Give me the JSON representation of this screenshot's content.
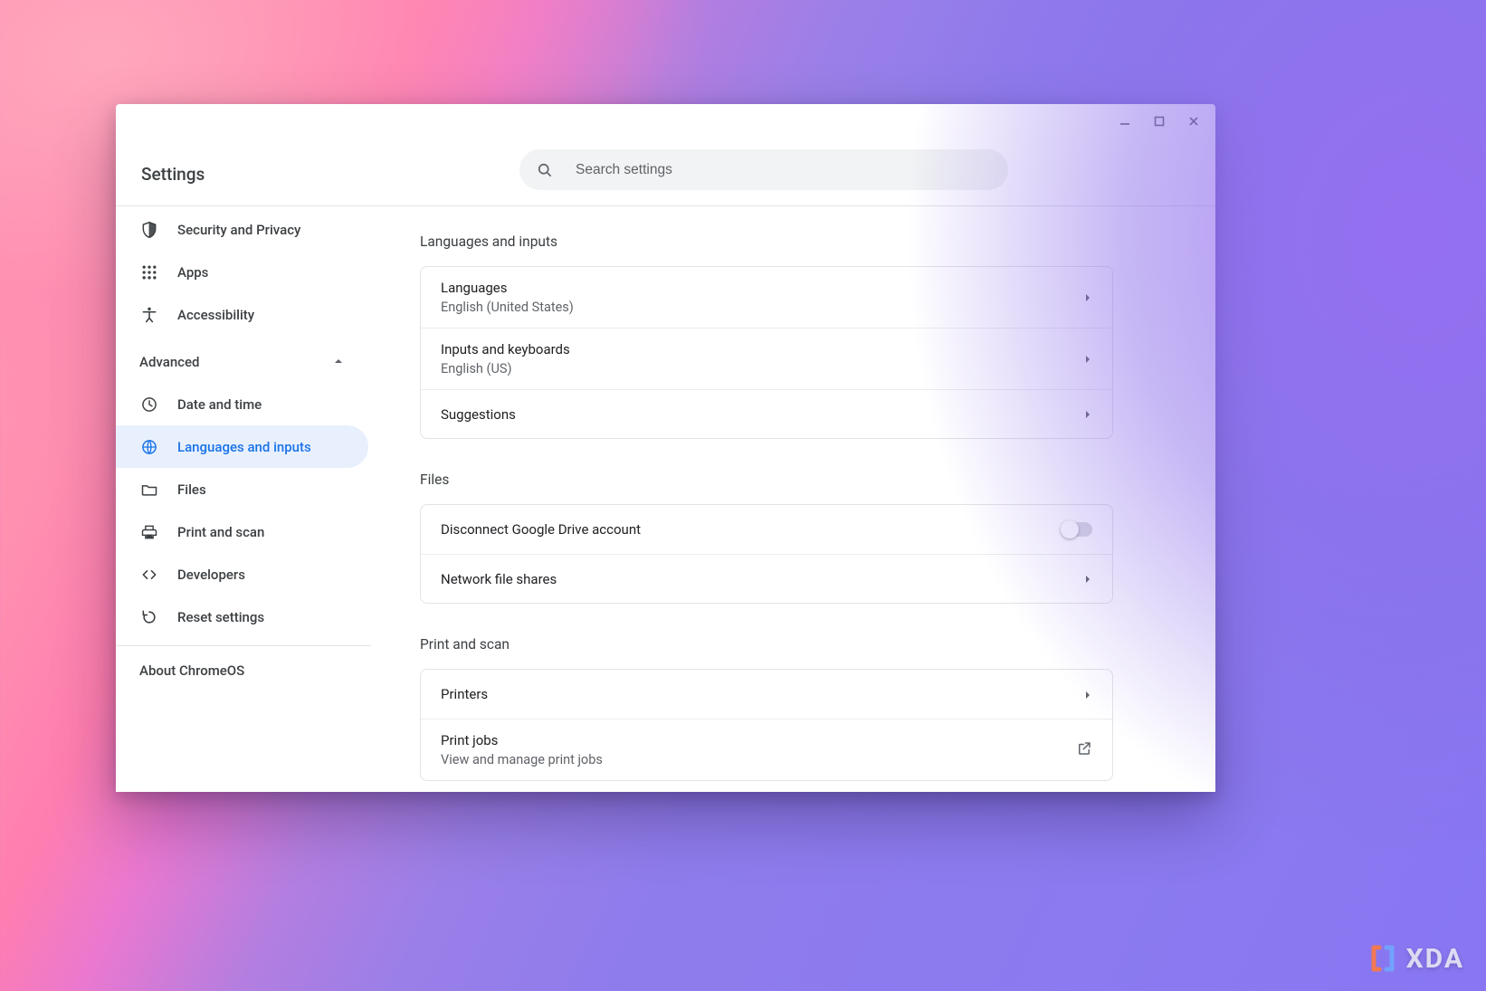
{
  "window": {
    "title": "Settings",
    "search_placeholder": "Search settings"
  },
  "sidebar": {
    "items": [
      {
        "id": "security-privacy",
        "label": "Security and Privacy",
        "selected": false
      },
      {
        "id": "apps",
        "label": "Apps",
        "selected": false
      },
      {
        "id": "accessibility",
        "label": "Accessibility",
        "selected": false
      }
    ],
    "advanced_label": "Advanced",
    "advanced_expanded": true,
    "advanced_items": [
      {
        "id": "date-time",
        "label": "Date and time",
        "selected": false
      },
      {
        "id": "languages-inputs",
        "label": "Languages and inputs",
        "selected": true
      },
      {
        "id": "files",
        "label": "Files",
        "selected": false
      },
      {
        "id": "print-scan",
        "label": "Print and scan",
        "selected": false
      },
      {
        "id": "developers",
        "label": "Developers",
        "selected": false
      },
      {
        "id": "reset-settings",
        "label": "Reset settings",
        "selected": false
      }
    ],
    "about_label": "About ChromeOS"
  },
  "sections": {
    "languages_inputs": {
      "heading": "Languages and inputs",
      "rows": {
        "languages": {
          "title": "Languages",
          "subtitle": "English (United States)"
        },
        "inputs": {
          "title": "Inputs and keyboards",
          "subtitle": "English (US)"
        },
        "suggestions": {
          "title": "Suggestions"
        }
      }
    },
    "files": {
      "heading": "Files",
      "rows": {
        "disconnect_drive": {
          "title": "Disconnect Google Drive account",
          "toggle_on": false
        },
        "network_shares": {
          "title": "Network file shares"
        }
      }
    },
    "print_scan": {
      "heading": "Print and scan",
      "rows": {
        "printers": {
          "title": "Printers"
        },
        "print_jobs": {
          "title": "Print jobs",
          "subtitle": "View and manage print jobs"
        }
      }
    }
  },
  "watermark": {
    "brand": "XDA"
  }
}
